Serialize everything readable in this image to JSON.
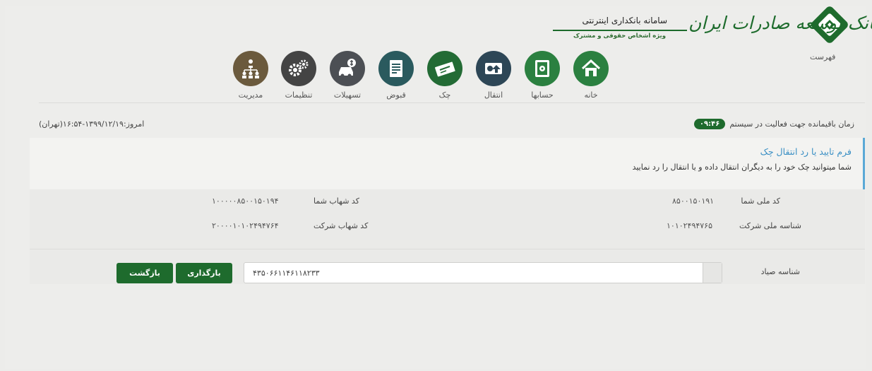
{
  "header": {
    "bank_name": "بانک توسعه صادرات ایران",
    "system_title": "سامانه بانکداری اینترنتی",
    "system_subtitle": "ویژه اشخاص حقوقی و مشترک",
    "menu_label": "فهرست",
    "brand_color": "#1e6b2d"
  },
  "nav": [
    {
      "label": "خانه",
      "icon": "home-icon",
      "color": "#2b8040"
    },
    {
      "label": "حسابها",
      "icon": "safe-icon",
      "color": "#2b8040"
    },
    {
      "label": "انتقال",
      "icon": "transfer-icon",
      "color": "#2d4656"
    },
    {
      "label": "چک",
      "icon": "cheque-icon",
      "color": "#236b35"
    },
    {
      "label": "قبوض",
      "icon": "bill-icon",
      "color": "#2a5a5e"
    },
    {
      "label": "تسهیلات",
      "icon": "car-loan-icon",
      "color": "#4c4f54"
    },
    {
      "label": "تنظیمات",
      "icon": "settings-icon",
      "color": "#444444"
    },
    {
      "label": "مدیریت",
      "icon": "hierarchy-icon",
      "color": "#6b5a3d"
    }
  ],
  "status": {
    "today": "امروز:۱۳۹۹/۱۲/۱۹-۱۶:۵۴(تهران)",
    "session_label": "زمان باقیمانده جهت فعالیت در سیستم",
    "session_time": "۰۹:۴۶"
  },
  "form": {
    "title": "فرم تایید یا رد انتقال چک",
    "description": "شما میتوانید چک خود را به دیگران انتقال داده و یا انتقال را رد نمایید",
    "national_code_label": "کد ملی شما",
    "national_code_value": "۸۵۰۰۱۵۰۱۹۱",
    "shahab_label": "کد شهاب شما",
    "shahab_value": "۱۰۰۰۰۰۸۵۰۰۱۵۰۱۹۴",
    "company_id_label": "شناسه ملی شرکت",
    "company_id_value": "۱۰۱۰۲۴۹۴۷۶۵",
    "company_shahab_label": "کد شهاب شرکت",
    "company_shahab_value": "۲۰۰۰۰۱۰۱۰۲۴۹۴۷۶۴",
    "sayad_label": "شناسه صیاد",
    "sayad_value": "۴۳۵۰۶۶۱۱۴۶۱۱۸۲۳۳",
    "load_button": "بارگذاری",
    "back_button": "بازگشت"
  }
}
